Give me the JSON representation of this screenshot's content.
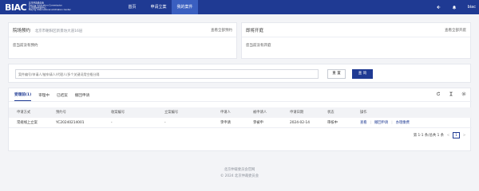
{
  "header": {
    "logo_mark": "BIAC",
    "logo_lines": [
      "北京仲裁委员会",
      "Beijing Arbitration Commission",
      "北京国际仲裁中心",
      "Beijing International Arbitration Center"
    ],
    "nav": [
      "首页",
      "申请立案",
      "我的案件"
    ],
    "active_nav": 2,
    "user": "biac",
    "icons": [
      "back-icon",
      "bell-icon"
    ]
  },
  "venue_card": {
    "title": "院场预约",
    "subtitle": "北京市朝阳区新景坊大道16层",
    "link": "查看全部预约",
    "empty": "您当前没有预约"
  },
  "session_card": {
    "title": "即将开庭",
    "link": "查看全部开庭",
    "empty": "您当前没有开庭"
  },
  "search": {
    "placeholder": "案件编号/申请人/被申请人/代理人/多个关键词用空格分隔",
    "reset_label": "重 置",
    "query_label": "查 询"
  },
  "tabs": [
    "受理前(1)",
    "审理中",
    "已结案",
    "撤回申请"
  ],
  "active_tab": 0,
  "toolbar_icons": [
    "refresh-icon",
    "column-height-icon",
    "settings-icon"
  ],
  "table": {
    "columns": [
      "申请方式",
      "预约号",
      "收案编号",
      "立案编号",
      "申请人",
      "被申请人",
      "申请日期",
      "状态",
      "操作"
    ],
    "rows": [
      {
        "method": "常规线上立案",
        "booking_no": "YC20240214001",
        "receipt_no": "-",
        "filing_no": "-",
        "applicant": "李申请",
        "respondent": "李被申",
        "date": "2024-02-14",
        "status": "审核中",
        "actions": [
          "查看",
          "撤回申请",
          "办理缴费"
        ]
      }
    ]
  },
  "pagination": {
    "summary": "第 1-1 条/总共 1 条",
    "prev": "<",
    "current": "1",
    "next": ">"
  },
  "footer": {
    "line1": "北京仲裁委员会官网",
    "line2": "© 2024 北京仲裁委员会"
  }
}
